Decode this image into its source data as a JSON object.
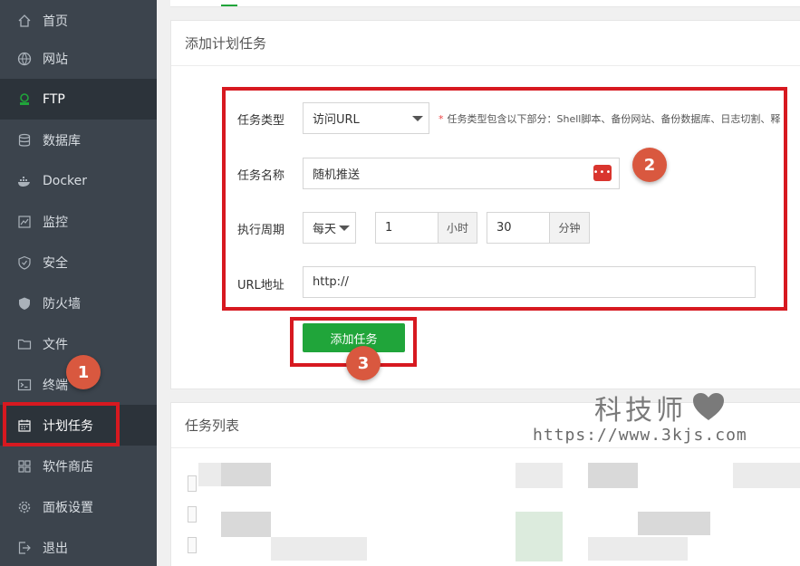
{
  "sidebar": {
    "items": [
      {
        "label": "首页",
        "icon": "home-icon"
      },
      {
        "label": "网站",
        "icon": "globe-icon"
      },
      {
        "label": "FTP",
        "icon": "ftp-icon"
      },
      {
        "label": "数据库",
        "icon": "database-icon"
      },
      {
        "label": "Docker",
        "icon": "docker-icon"
      },
      {
        "label": "监控",
        "icon": "monitor-icon"
      },
      {
        "label": "安全",
        "icon": "shield-icon"
      },
      {
        "label": "防火墙",
        "icon": "firewall-icon"
      },
      {
        "label": "文件",
        "icon": "folder-icon"
      },
      {
        "label": "终端",
        "icon": "terminal-icon"
      },
      {
        "label": "计划任务",
        "icon": "calendar-icon"
      },
      {
        "label": "软件商店",
        "icon": "apps-icon"
      },
      {
        "label": "面板设置",
        "icon": "gear-icon"
      },
      {
        "label": "退出",
        "icon": "logout-icon"
      }
    ]
  },
  "add_task": {
    "title": "添加计划任务",
    "task_type_label": "任务类型",
    "task_type_value": "访问URL",
    "task_type_hint_star": "*",
    "task_type_hint": "任务类型包含以下部分：Shell脚本、备份网站、备份数据库、日志切割、释",
    "task_name_label": "任务名称",
    "task_name_value": "随机推送",
    "cycle_label": "执行周期",
    "cycle_value": "每天",
    "hour_value": "1",
    "hour_unit": "小时",
    "minute_value": "30",
    "minute_unit": "分钟",
    "url_label": "URL地址",
    "url_value": "http://",
    "submit_label": "添加任务"
  },
  "task_list": {
    "title": "任务列表"
  },
  "annotations": {
    "badge_1": "1",
    "badge_2": "2",
    "badge_3": "3"
  },
  "watermark": {
    "title": "科技师",
    "url": "https://www.3kjs.com"
  },
  "colors": {
    "sidebar_bg": "#3c444d",
    "accent_green": "#20a53a",
    "highlight_red": "#d71920",
    "badge_orange": "#d9583f"
  }
}
